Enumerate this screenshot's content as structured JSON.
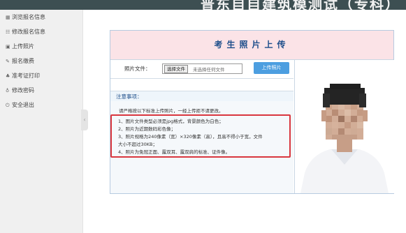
{
  "header": {
    "title": "普东自自建筑模测试（专科）"
  },
  "sidebar": {
    "items": [
      {
        "icon": "▦",
        "icon_name": "browse-icon",
        "label": "浏览报名信息"
      },
      {
        "icon": "☷",
        "icon_name": "edit-info-icon",
        "label": "修改报名信息"
      },
      {
        "icon": "▣",
        "icon_name": "photo-icon",
        "label": "上传照片"
      },
      {
        "icon": "✎",
        "icon_name": "payment-icon",
        "label": "报名缴费"
      },
      {
        "icon": "♣",
        "icon_name": "print-icon",
        "label": "准考证打印"
      },
      {
        "icon": "♁",
        "icon_name": "password-icon",
        "label": "修改密码"
      },
      {
        "icon": "⏻",
        "icon_name": "logout-icon",
        "label": "安全退出"
      }
    ],
    "collapse_glyph": "‹"
  },
  "upload_panel": {
    "title": "考生照片上传",
    "file_label": "照片文件：",
    "choose_button": "选择文件",
    "no_file_text": "未选择任何文件",
    "upload_button": "上传照片"
  },
  "notice": {
    "title": "注意事项：",
    "intro": "请严格按以下标准上传照片，一经上传拒不请更改。",
    "rules": [
      "1、图片文件类型必须是jpg格式，背景颜色为白色；",
      "2、照片为近期数码彩色像；",
      "3、照片规格为240像素（宽）×320像素（高），且高不得小于宽，文件",
      "大小不超过30KB；",
      "4、照片为免冠正面、露双耳、露双肩的标准、证件像。"
    ]
  },
  "colors": {
    "topbar": "#3d4f52",
    "sidebar_bg": "#f0f0f0",
    "panel_header_bg": "#fbe3e7",
    "title_text": "#1c4d8a",
    "upload_button": "#4c9ee0",
    "highlight_border": "#d9363e"
  }
}
